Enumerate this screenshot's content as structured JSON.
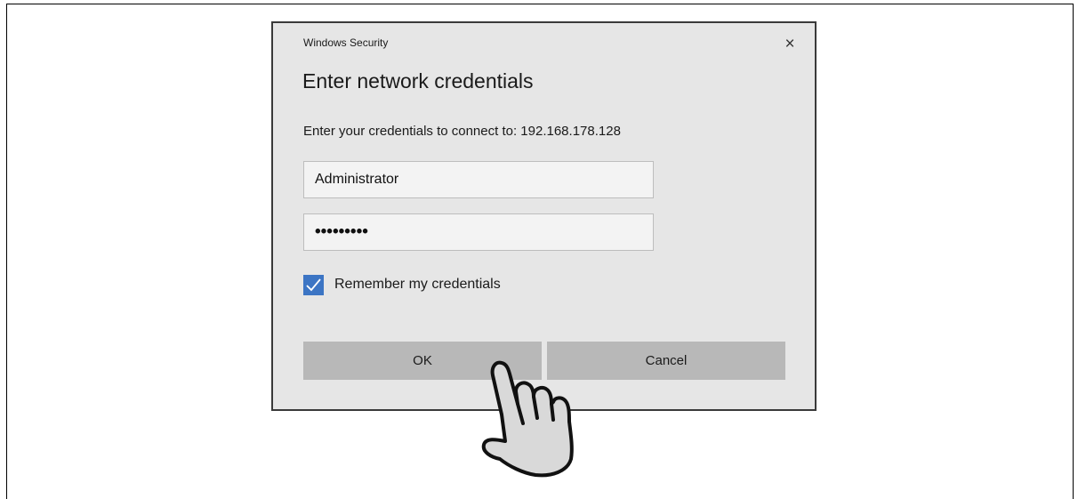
{
  "dialog": {
    "caption": "Windows Security",
    "close_glyph": "×",
    "title": "Enter network credentials",
    "message": "Enter your credentials to connect to: 192.168.178.128",
    "username_value": "Administrator",
    "password_value": "•••••••••",
    "remember_label": "Remember my credentials",
    "remember_checked": true,
    "ok_label": "OK",
    "cancel_label": "Cancel"
  },
  "colors": {
    "dialog_bg": "#e6e6e6",
    "button_bg": "#b8b8b8",
    "checkbox_accent": "#3c75c4"
  },
  "icons": {
    "close": "close-icon",
    "check": "checkmark-icon",
    "pointer": "pointing-hand-icon"
  }
}
